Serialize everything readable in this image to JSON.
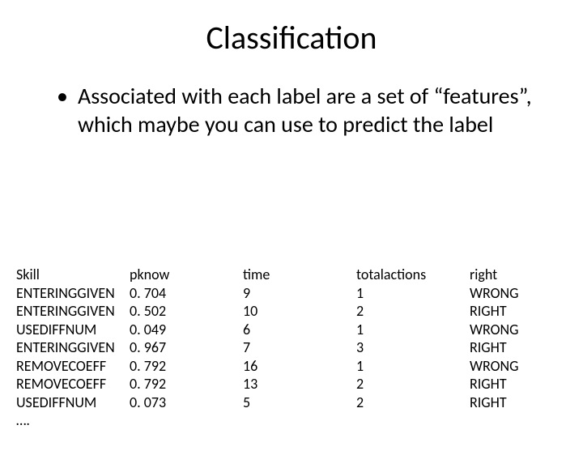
{
  "title": "Classification",
  "bullet": "Associated with each label are a set of “features”, which maybe you can use to predict the label",
  "table": {
    "headers": {
      "skill": "Skill",
      "pknow": "pknow",
      "time": "time",
      "totalactions": "totalactions",
      "right": "right"
    },
    "rows": [
      {
        "skill": "ENTERINGGIVEN",
        "pknow": "0. 704",
        "time": "9",
        "totalactions": "1",
        "right": "WRONG"
      },
      {
        "skill": "ENTERINGGIVEN",
        "pknow": "0. 502",
        "time": "10",
        "totalactions": "2",
        "right": "RIGHT"
      },
      {
        "skill": "USEDIFFNUM",
        "pknow": "0. 049",
        "time": "6",
        "totalactions": "1",
        "right": "WRONG"
      },
      {
        "skill": "ENTERINGGIVEN",
        "pknow": "0. 967",
        "time": "7",
        "totalactions": "3",
        "right": "RIGHT"
      },
      {
        "skill": "REMOVECOEFF",
        "pknow": "0. 792",
        "time": "16",
        "totalactions": "1",
        "right": "WRONG"
      },
      {
        "skill": "REMOVECOEFF",
        "pknow": "0. 792",
        "time": "13",
        "totalactions": "2",
        "right": "RIGHT"
      },
      {
        "skill": "USEDIFFNUM",
        "pknow": "0. 073",
        "time": "5",
        "totalactions": "2",
        "right": "RIGHT"
      }
    ],
    "trailing": "…."
  }
}
